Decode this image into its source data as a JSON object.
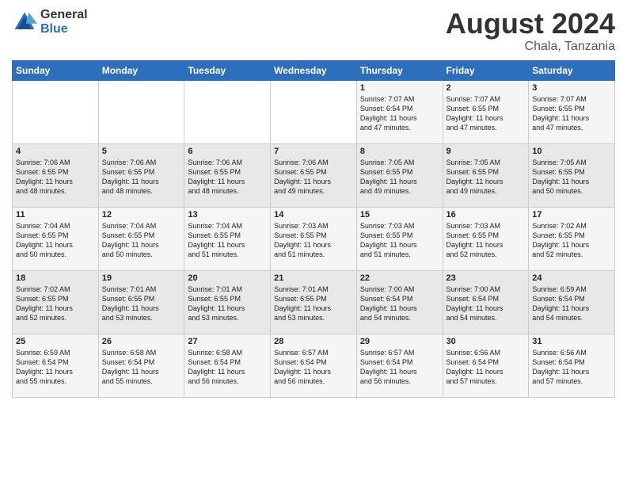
{
  "logo": {
    "general": "General",
    "blue": "Blue"
  },
  "title": {
    "month_year": "August 2024",
    "location": "Chala, Tanzania"
  },
  "days_of_week": [
    "Sunday",
    "Monday",
    "Tuesday",
    "Wednesday",
    "Thursday",
    "Friday",
    "Saturday"
  ],
  "weeks": [
    [
      {
        "day": "",
        "info": ""
      },
      {
        "day": "",
        "info": ""
      },
      {
        "day": "",
        "info": ""
      },
      {
        "day": "",
        "info": ""
      },
      {
        "day": "1",
        "info": "Sunrise: 7:07 AM\nSunset: 6:54 PM\nDaylight: 11 hours\nand 47 minutes."
      },
      {
        "day": "2",
        "info": "Sunrise: 7:07 AM\nSunset: 6:55 PM\nDaylight: 11 hours\nand 47 minutes."
      },
      {
        "day": "3",
        "info": "Sunrise: 7:07 AM\nSunset: 6:55 PM\nDaylight: 11 hours\nand 47 minutes."
      }
    ],
    [
      {
        "day": "4",
        "info": "Sunrise: 7:06 AM\nSunset: 6:55 PM\nDaylight: 11 hours\nand 48 minutes."
      },
      {
        "day": "5",
        "info": "Sunrise: 7:06 AM\nSunset: 6:55 PM\nDaylight: 11 hours\nand 48 minutes."
      },
      {
        "day": "6",
        "info": "Sunrise: 7:06 AM\nSunset: 6:55 PM\nDaylight: 11 hours\nand 48 minutes."
      },
      {
        "day": "7",
        "info": "Sunrise: 7:06 AM\nSunset: 6:55 PM\nDaylight: 11 hours\nand 49 minutes."
      },
      {
        "day": "8",
        "info": "Sunrise: 7:05 AM\nSunset: 6:55 PM\nDaylight: 11 hours\nand 49 minutes."
      },
      {
        "day": "9",
        "info": "Sunrise: 7:05 AM\nSunset: 6:55 PM\nDaylight: 11 hours\nand 49 minutes."
      },
      {
        "day": "10",
        "info": "Sunrise: 7:05 AM\nSunset: 6:55 PM\nDaylight: 11 hours\nand 50 minutes."
      }
    ],
    [
      {
        "day": "11",
        "info": "Sunrise: 7:04 AM\nSunset: 6:55 PM\nDaylight: 11 hours\nand 50 minutes."
      },
      {
        "day": "12",
        "info": "Sunrise: 7:04 AM\nSunset: 6:55 PM\nDaylight: 11 hours\nand 50 minutes."
      },
      {
        "day": "13",
        "info": "Sunrise: 7:04 AM\nSunset: 6:55 PM\nDaylight: 11 hours\nand 51 minutes."
      },
      {
        "day": "14",
        "info": "Sunrise: 7:03 AM\nSunset: 6:55 PM\nDaylight: 11 hours\nand 51 minutes."
      },
      {
        "day": "15",
        "info": "Sunrise: 7:03 AM\nSunset: 6:55 PM\nDaylight: 11 hours\nand 51 minutes."
      },
      {
        "day": "16",
        "info": "Sunrise: 7:03 AM\nSunset: 6:55 PM\nDaylight: 11 hours\nand 52 minutes."
      },
      {
        "day": "17",
        "info": "Sunrise: 7:02 AM\nSunset: 6:55 PM\nDaylight: 11 hours\nand 52 minutes."
      }
    ],
    [
      {
        "day": "18",
        "info": "Sunrise: 7:02 AM\nSunset: 6:55 PM\nDaylight: 11 hours\nand 52 minutes."
      },
      {
        "day": "19",
        "info": "Sunrise: 7:01 AM\nSunset: 6:55 PM\nDaylight: 11 hours\nand 53 minutes."
      },
      {
        "day": "20",
        "info": "Sunrise: 7:01 AM\nSunset: 6:55 PM\nDaylight: 11 hours\nand 53 minutes."
      },
      {
        "day": "21",
        "info": "Sunrise: 7:01 AM\nSunset: 6:55 PM\nDaylight: 11 hours\nand 53 minutes."
      },
      {
        "day": "22",
        "info": "Sunrise: 7:00 AM\nSunset: 6:54 PM\nDaylight: 11 hours\nand 54 minutes."
      },
      {
        "day": "23",
        "info": "Sunrise: 7:00 AM\nSunset: 6:54 PM\nDaylight: 11 hours\nand 54 minutes."
      },
      {
        "day": "24",
        "info": "Sunrise: 6:59 AM\nSunset: 6:54 PM\nDaylight: 11 hours\nand 54 minutes."
      }
    ],
    [
      {
        "day": "25",
        "info": "Sunrise: 6:59 AM\nSunset: 6:54 PM\nDaylight: 11 hours\nand 55 minutes."
      },
      {
        "day": "26",
        "info": "Sunrise: 6:58 AM\nSunset: 6:54 PM\nDaylight: 11 hours\nand 55 minutes."
      },
      {
        "day": "27",
        "info": "Sunrise: 6:58 AM\nSunset: 6:54 PM\nDaylight: 11 hours\nand 56 minutes."
      },
      {
        "day": "28",
        "info": "Sunrise: 6:57 AM\nSunset: 6:54 PM\nDaylight: 11 hours\nand 56 minutes."
      },
      {
        "day": "29",
        "info": "Sunrise: 6:57 AM\nSunset: 6:54 PM\nDaylight: 11 hours\nand 56 minutes."
      },
      {
        "day": "30",
        "info": "Sunrise: 6:56 AM\nSunset: 6:54 PM\nDaylight: 11 hours\nand 57 minutes."
      },
      {
        "day": "31",
        "info": "Sunrise: 6:56 AM\nSunset: 6:54 PM\nDaylight: 11 hours\nand 57 minutes."
      }
    ]
  ]
}
